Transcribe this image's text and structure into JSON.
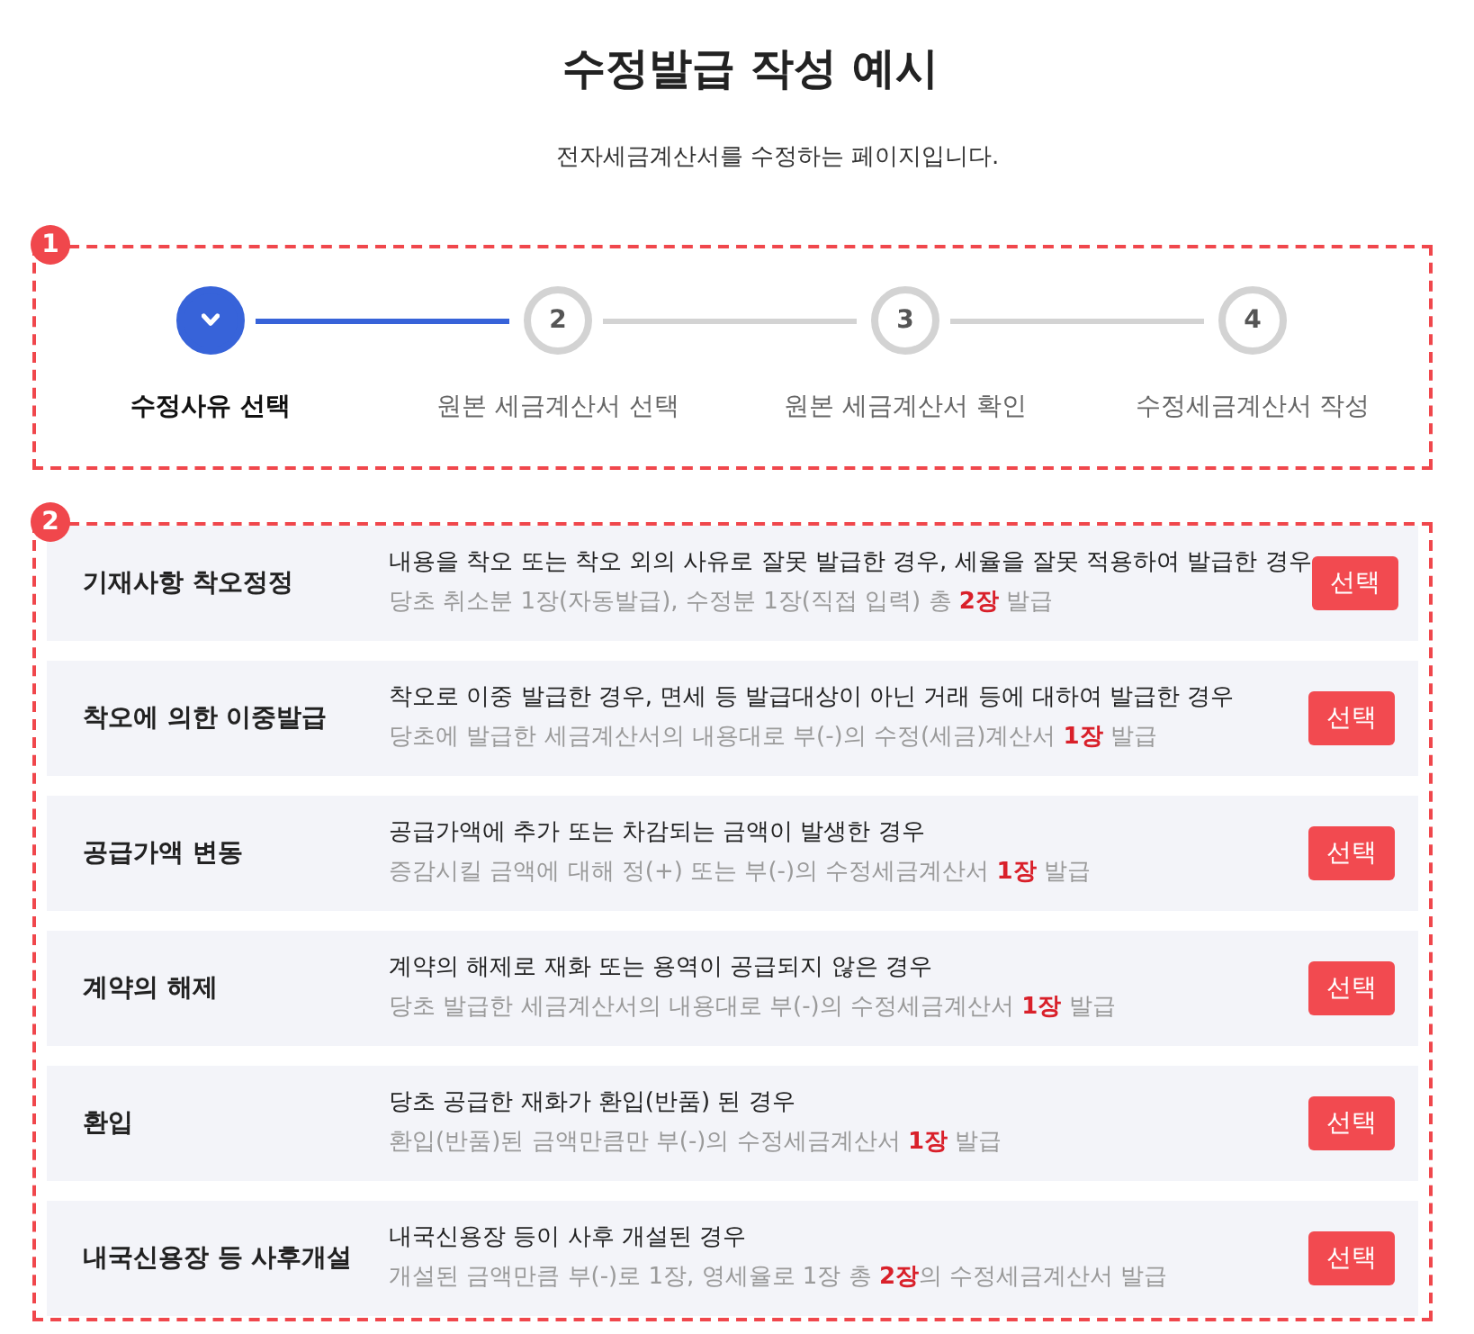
{
  "page": {
    "title": "수정발급 작성 예시",
    "subtitle": "전자세금계산서를 수정하는 페이지입니다."
  },
  "step_section": {
    "badge": "1",
    "steps": [
      {
        "label": "수정사유 선택",
        "active": true
      },
      {
        "number": "2",
        "label": "원본 세금계산서 선택",
        "active": false
      },
      {
        "number": "3",
        "label": "원본 세금계산서 확인",
        "active": false
      },
      {
        "number": "4",
        "label": "수정세금계산서 작성",
        "active": false
      }
    ]
  },
  "reason_section": {
    "badge": "2",
    "reasons": [
      {
        "title": "기재사항 착오정정",
        "description": "내용을 착오 또는 착오 외의 사유로 잘못 발급한 경우, 세율을 잘못 적용하여 발급한 경우",
        "detail": "당초 취소분 1장(자동발급), 수정분 1장(직접 입력) 총 **2장** 발급",
        "button": "선택"
      },
      {
        "title": "착오에 의한 이중발급",
        "description": "착오로 이중 발급한 경우, 면세 등 발급대상이 아닌 거래 등에 대하여 발급한 경우",
        "detail": "당초에 발급한 세금계산서의 내용대로 부(-)의 수정(세금)계산서 **1장** 발급",
        "button": "선택"
      },
      {
        "title": "공급가액 변동",
        "description": "공급가액에 추가 또는 차감되는 금액이 발생한 경우",
        "detail": "증감시킬 금액에 대해 정(+) 또는 부(-)의 수정세금계산서 **1장** 발급",
        "button": "선택"
      },
      {
        "title": "계약의 해제",
        "description": "계약의 해제로 재화 또는 용역이 공급되지 않은 경우",
        "detail": "당초 발급한 세금계산서의 내용대로 부(-)의 수정세금계산서 **1장** 발급",
        "button": "선택"
      },
      {
        "title": "환입",
        "description": "당초 공급한 재화가 환입(반품) 된 경우",
        "detail": "환입(반품)된 금액만큼만 부(-)의 수정세금계산서 **1장** 발급",
        "button": "선택"
      },
      {
        "title": "내국신용장 등 사후개설",
        "description": "내국신용장 등이 사후 개설된 경우",
        "detail": "개설된 금액만큼 부(-)로 1장, 영세율로 1장 총 **2장**의 수정세금계산서 발급",
        "button": "선택"
      }
    ]
  }
}
